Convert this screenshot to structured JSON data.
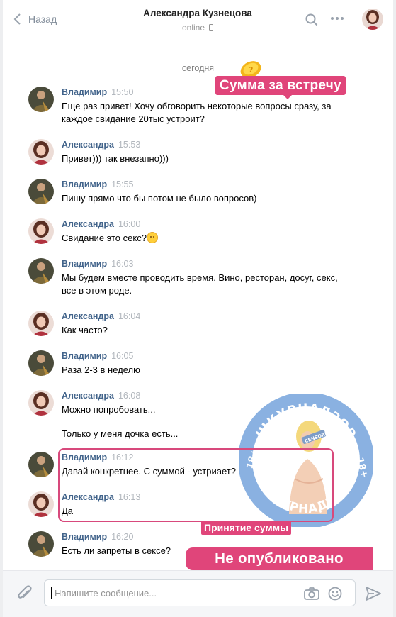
{
  "header": {
    "back_label": "Назад",
    "title": "Александра Кузнецова",
    "status": "online"
  },
  "date_separator": "сегодня",
  "messages": [
    {
      "author": "Владимир",
      "time": "15:50",
      "text": "Еще раз привет! Хочу обговорить некоторые вопросы сразу, за каждое свидание 20тыс устроит?"
    },
    {
      "author": "Александра",
      "time": "15:53",
      "text": "Привет))) так внезапно)))"
    },
    {
      "author": "Владимир",
      "time": "15:55",
      "text": "Пишу прямо что бы потом не было вопросов)"
    },
    {
      "author": "Александра",
      "time": "16:00",
      "text": "Свидание это секс?"
    },
    {
      "author": "Владимир",
      "time": "16:03",
      "text": "Мы будем вместе проводить время. Вино, ресторан, досуг, секс, все в этом роде."
    },
    {
      "author": "Александра",
      "time": "16:04",
      "text": "Как часто?"
    },
    {
      "author": "Владимир",
      "time": "16:05",
      "text": "Раза 2-3 в неделю"
    },
    {
      "author": "Александра",
      "time": "16:08",
      "text": "Можно попробовать...",
      "text2": "Только у меня дочка есть..."
    },
    {
      "author": "Владимир",
      "time": "16:12",
      "text": "Давай конкретнее. С суммой - устриает?"
    },
    {
      "author": "Александра",
      "time": "16:13",
      "text": "Да"
    },
    {
      "author": "Владимир",
      "time": "16:20",
      "text": "Есть ли запреты в сексе?"
    }
  ],
  "overlays": {
    "sum_badge": "Сумма за встречу",
    "accept_badge": "Принятие суммы",
    "unpublished_badge": "Не опубликовано",
    "seal_top": "ШКУРНАДЗОР",
    "seal_bottom": "ШКУРНАДЗОР",
    "seal_age": "18+",
    "seal_censored": "CENSORED"
  },
  "composer": {
    "placeholder": "Напишите сообщение..."
  },
  "colors": {
    "accent": "#e0457a",
    "author": "#42648b",
    "seal_ring": "#7aa7dd"
  }
}
